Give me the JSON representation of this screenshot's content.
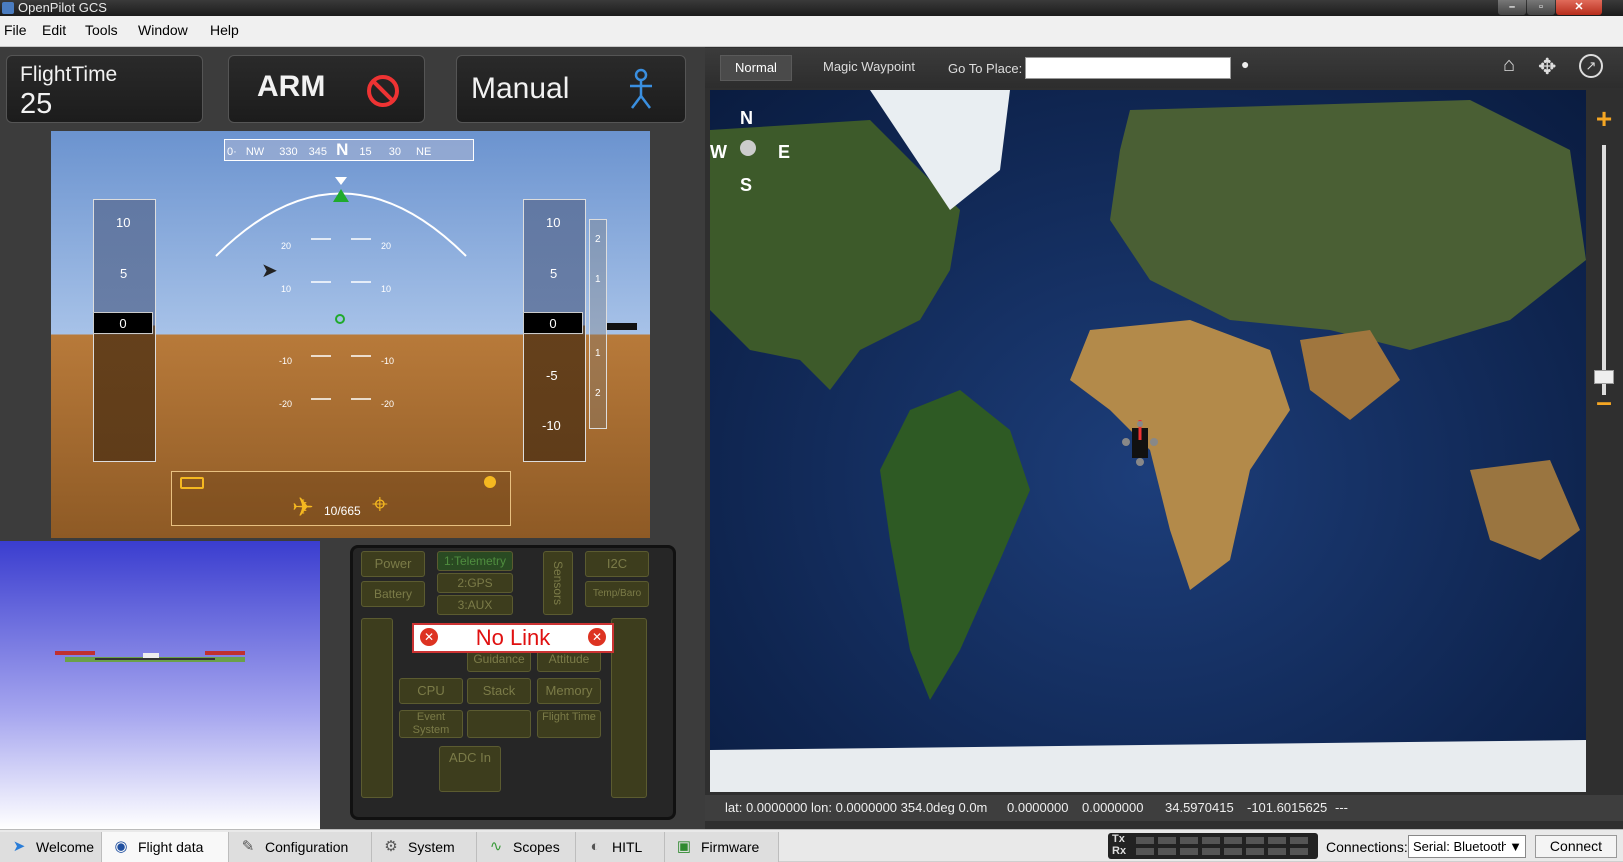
{
  "window": {
    "title": "OpenPilot GCS"
  },
  "menu": [
    "File",
    "Edit",
    "Tools",
    "Window",
    "Help"
  ],
  "tiles": {
    "flighttime_label": "FlightTime",
    "flighttime_value": "25",
    "arm_label": "ARM",
    "mode_label": "Manual"
  },
  "pfd": {
    "compass_labels": [
      "0·",
      "NW",
      "330",
      "345",
      "N",
      "15",
      "30",
      "NE"
    ],
    "pitch_labels": {
      "p20": "20",
      "p10": "10",
      "m10": "-10",
      "m20": "-20"
    },
    "speed_ticks": [
      "10",
      "5",
      "0"
    ],
    "alt_ticks_top": [
      "10",
      "5"
    ],
    "alt_ticks_bottom": [
      "-5",
      "-10"
    ],
    "speed_value": "0",
    "alt_value": "0",
    "vario_ticks": [
      "2",
      "1",
      "1",
      "2"
    ],
    "waypoint_text": "10/665"
  },
  "system": {
    "boxes": [
      "Power",
      "Battery",
      "1:Telemetry",
      "2:GPS",
      "3:AUX",
      "Sensors",
      "I2C",
      "Temp/Baro",
      "Guidance",
      "Attitude",
      "CPU",
      "Stack",
      "Memory",
      "Event System",
      "Flight Time",
      "ADC In"
    ],
    "nolink": "No Link"
  },
  "map": {
    "tabs": [
      "Normal",
      "Magic Waypoint"
    ],
    "goto_label": "Go To Place:",
    "goto_value": "",
    "compass": {
      "n": "N",
      "s": "S",
      "e": "E",
      "w": "W"
    }
  },
  "status": {
    "latlon": "lat: 0.0000000 lon: 0.0000000 354.0deg 0.0m",
    "coords1": "0.0000000",
    "coords2": "0.0000000",
    "coords3": "34.5970415",
    "coords4": "-101.6015625",
    "dashes": "---"
  },
  "bottom": {
    "tabs": [
      "Welcome",
      "Flight data",
      "Configuration",
      "System",
      "Scopes",
      "HITL",
      "Firmware"
    ],
    "active_tab": "Flight data",
    "txrx_tx": "Tx",
    "txrx_rx": "Rx",
    "connections_label": "Connections:",
    "connection_value": "Serial: Bluetooth",
    "connect_label": "Connect"
  }
}
